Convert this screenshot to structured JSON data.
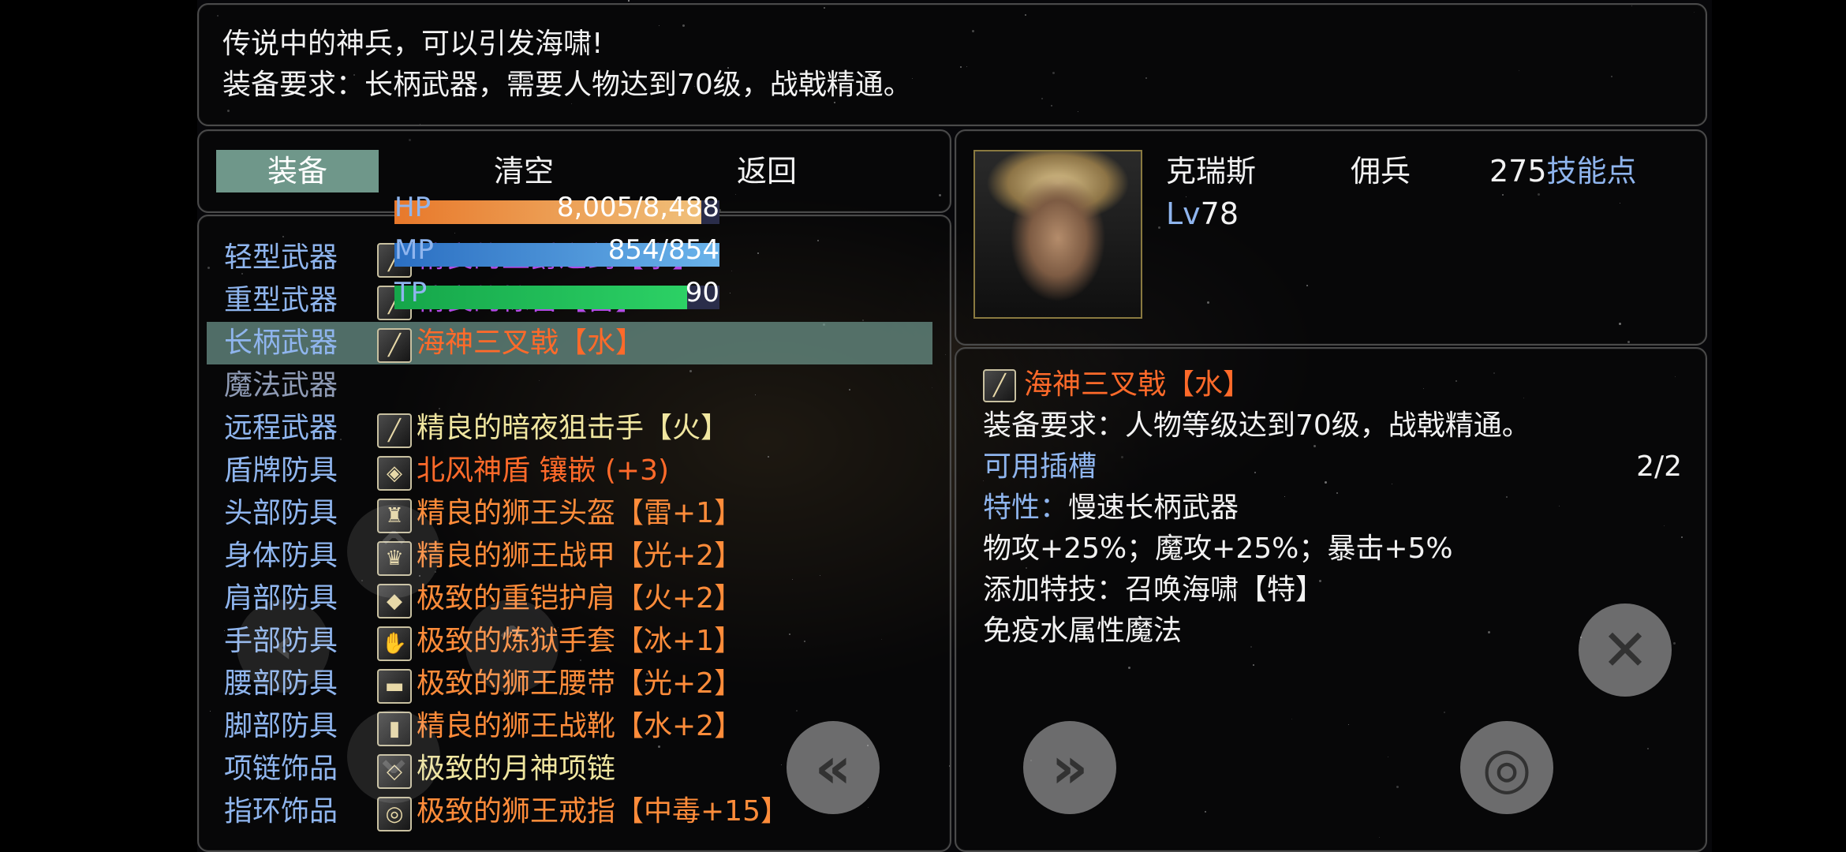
{
  "description": {
    "line1": "传说中的神兵，可以引发海啸!",
    "line2": "装备要求：长柄武器，需要人物达到70级，战戟精通。"
  },
  "tabs": {
    "equip": "装备",
    "clear": "清空",
    "back": "返回"
  },
  "slots": [
    {
      "label": "轻型武器",
      "icon": "sword-icon",
      "glyph": "╱",
      "item": "精良的王爵之剑【水】",
      "color": "#b24ce6"
    },
    {
      "label": "重型武器",
      "icon": "blade-icon",
      "glyph": "╱",
      "item": "精良的惊雷【雷】",
      "color": "#b24ce6"
    },
    {
      "label": "长柄武器",
      "icon": "trident-icon",
      "glyph": "╱",
      "item": "海神三叉戟【水】",
      "color": "#ff6a2a",
      "selected": true
    },
    {
      "label": "魔法武器",
      "icon": "",
      "glyph": "",
      "item": "",
      "color": "#8f9bb5",
      "dim": true
    },
    {
      "label": "远程武器",
      "icon": "rifle-icon",
      "glyph": "╱",
      "item": "精良的暗夜狙击手【火】",
      "color": "#f0e6a0"
    },
    {
      "label": "盾牌防具",
      "icon": "shield-icon",
      "glyph": "◈",
      "item": "北风神盾 镶嵌 (+3)",
      "color": "#ff6a2a"
    },
    {
      "label": "头部防具",
      "icon": "helmet-icon",
      "glyph": "♜",
      "item": "精良的狮王头盔【雷+1】",
      "color": "#ff8c3a"
    },
    {
      "label": "身体防具",
      "icon": "armor-icon",
      "glyph": "♛",
      "item": "精良的狮王战甲【光+2】",
      "color": "#ff8c3a"
    },
    {
      "label": "肩部防具",
      "icon": "pauldron-icon",
      "glyph": "◆",
      "item": "极致的重铠护肩【火+2】",
      "color": "#ff8c3a"
    },
    {
      "label": "手部防具",
      "icon": "gauntlet-icon",
      "glyph": "✋",
      "item": "极致的炼狱手套【冰+1】",
      "color": "#ff8c3a"
    },
    {
      "label": "腰部防具",
      "icon": "belt-icon",
      "glyph": "▬",
      "item": "极致的狮王腰带【光+2】",
      "color": "#ff8c3a"
    },
    {
      "label": "脚部防具",
      "icon": "boots-icon",
      "glyph": "▮",
      "item": "精良的狮王战靴【水+2】",
      "color": "#ff8c3a"
    },
    {
      "label": "项链饰品",
      "icon": "necklace-icon",
      "glyph": "◇",
      "item": "极致的月神项链",
      "color": "#f0e6a0"
    },
    {
      "label": "指环饰品",
      "icon": "ring-icon",
      "glyph": "◎",
      "item": "极致的狮王戒指【中毒+15】",
      "color": "#ff8c3a"
    }
  ],
  "character": {
    "name": "克瑞斯",
    "level_prefix": "Lv",
    "level": "78",
    "class": "佣兵",
    "skill_points": "275",
    "skill_points_label": "技能点",
    "hp": {
      "label": "HP",
      "value": "8,005/8,488",
      "fraction": 0.943
    },
    "mp": {
      "label": "MP",
      "value": "854/854",
      "fraction": 1.0
    },
    "tp": {
      "label": "TP",
      "value": "90",
      "fraction": 0.9
    }
  },
  "detail": {
    "item_name": "海神三叉戟【水】",
    "item_color": "#ff6a2a",
    "requirement": "装备要求：人物等级达到70级，战戟精通。",
    "sockets_label": "可用插槽",
    "sockets_value": "2/2",
    "trait": "特性：慢速长柄武器",
    "stats": "物攻+25%；魔攻+25%；暴击+5%",
    "skill": "添加特技：召唤海啸【特】",
    "immunity": "免疫水属性魔法"
  },
  "controls": {
    "prev": "«",
    "next": "»",
    "close": "✕",
    "confirm": "◎"
  },
  "colors": {
    "label_blue": "#8fb5ee",
    "selected_row": "#6f978a",
    "hp_bar": "#f0a050",
    "mp_bar": "#4a9ae0",
    "tp_bar": "#20c058"
  }
}
